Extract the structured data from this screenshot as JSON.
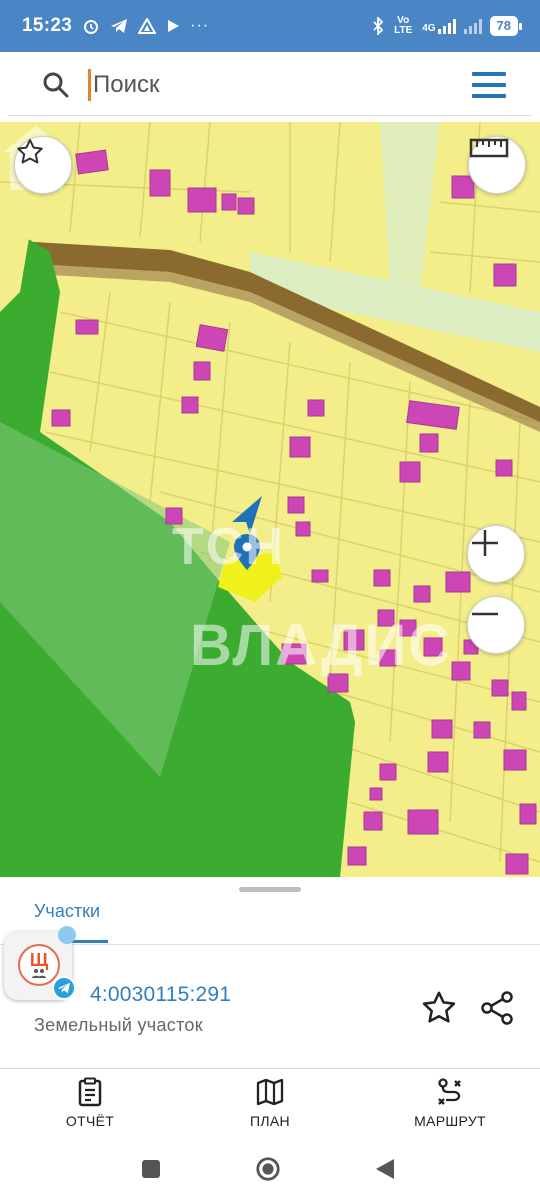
{
  "status_bar": {
    "time": "15:23",
    "battery": "78",
    "network_top": "4G",
    "network_volte": "Vo LTE",
    "more": "···"
  },
  "search": {
    "placeholder": "Поиск"
  },
  "map": {
    "watermark_top": "TCH",
    "watermark_bottom": "ВЛАДИС",
    "colors": {
      "plots": "#f3ee8a",
      "buildings": "#cc47b5",
      "forest": "#3bac2f",
      "road": "#8b6a2f",
      "selected_plot": "#f0f01a",
      "marker": "#1f72b8"
    },
    "controls": {
      "favorite": "star-icon",
      "ruler": "ruler-icon",
      "zoom_in": "plus-icon",
      "zoom_out": "minus-icon"
    }
  },
  "sheet": {
    "tab_label": "Участки",
    "cadastral_number": "50:14:0030115:291",
    "cadastral_visible": "4:0030115:291",
    "plot_type": "Земельный участок"
  },
  "bubble": {
    "avatar_letter": "Щ"
  },
  "bottom_nav": {
    "report": "ОТЧЁТ",
    "plan": "ПЛАН",
    "route": "МАРШРУТ"
  }
}
